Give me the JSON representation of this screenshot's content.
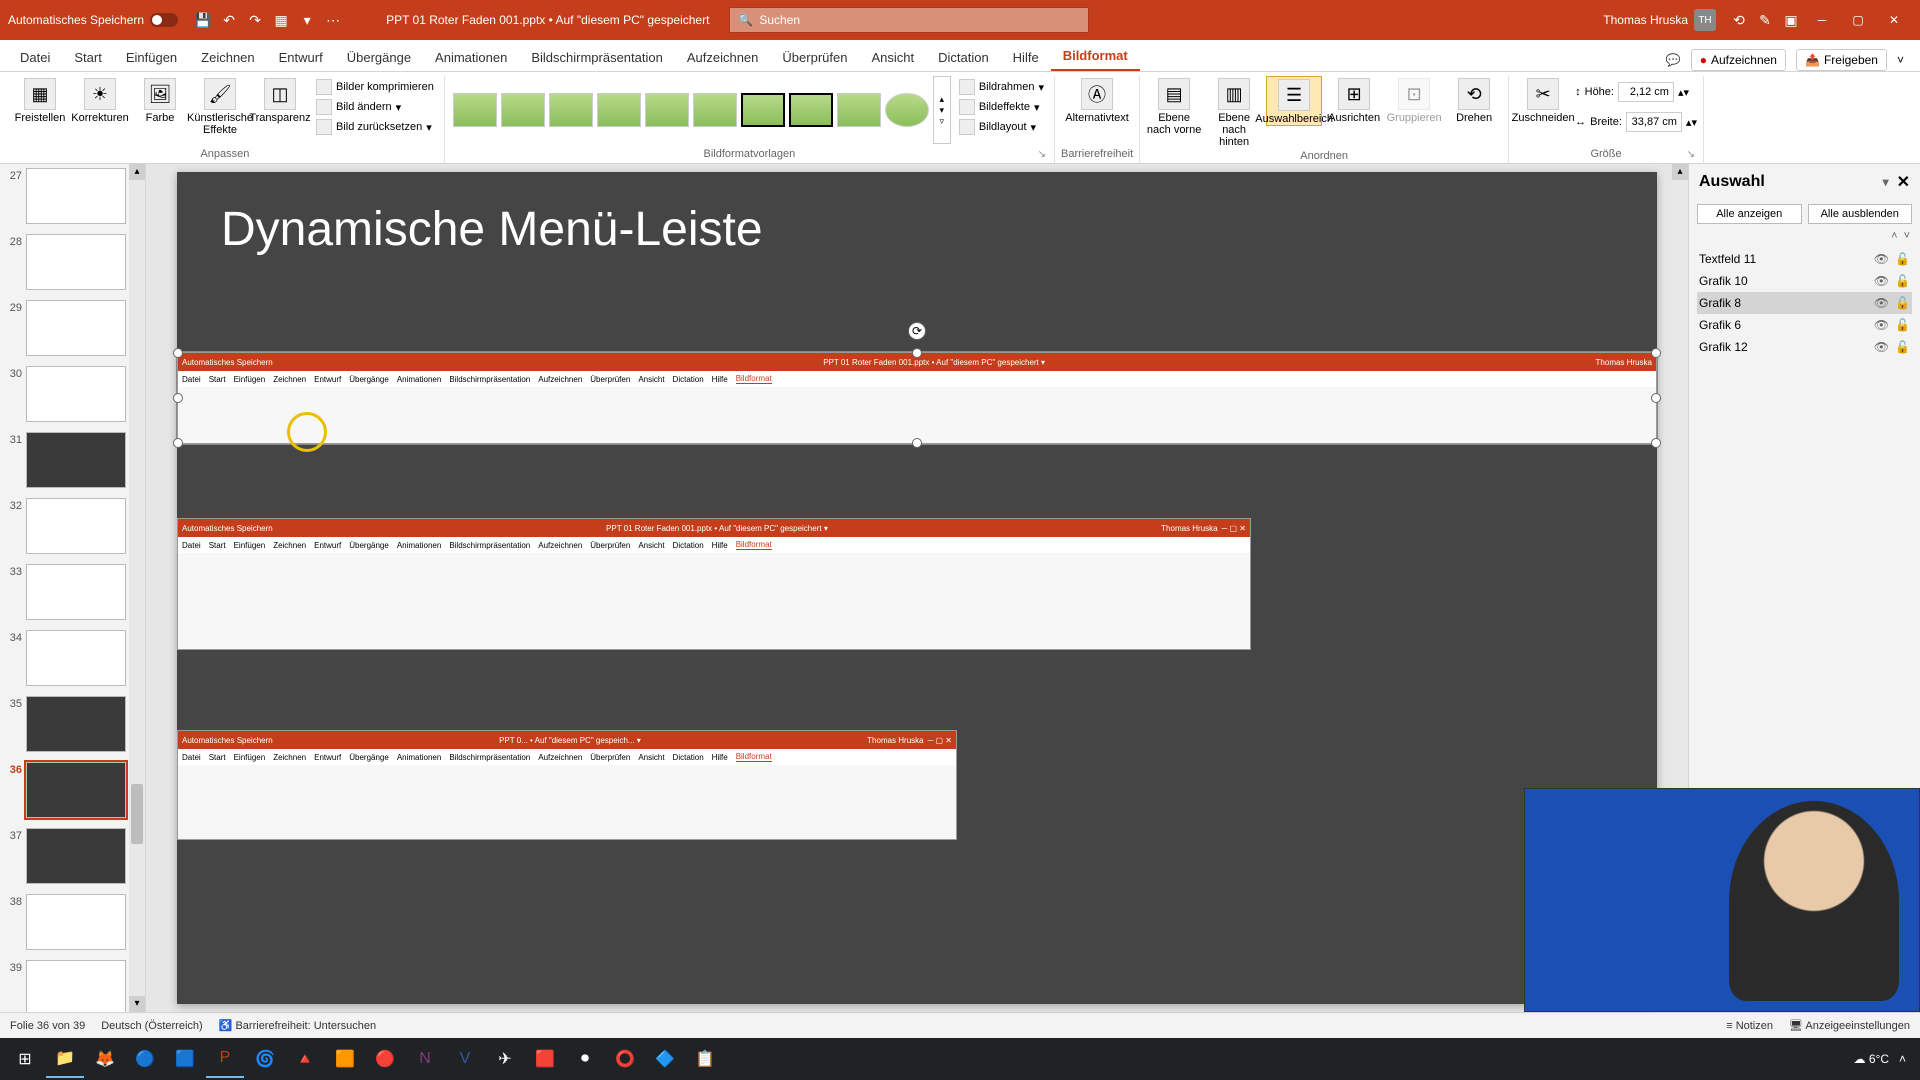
{
  "titlebar": {
    "autosave": "Automatisches Speichern",
    "doc_title": "PPT 01 Roter Faden 001.pptx • Auf \"diesem PC\" gespeichert",
    "search_placeholder": "Suchen",
    "user_name": "Thomas Hruska",
    "user_initials": "TH"
  },
  "tabs": {
    "datei": "Datei",
    "start": "Start",
    "einfuegen": "Einfügen",
    "zeichnen": "Zeichnen",
    "entwurf": "Entwurf",
    "uebergaenge": "Übergänge",
    "animationen": "Animationen",
    "bildschirm": "Bildschirmpräsentation",
    "aufzeichnen": "Aufzeichnen",
    "ueberpruefen": "Überprüfen",
    "ansicht": "Ansicht",
    "dictation": "Dictation",
    "hilfe": "Hilfe",
    "bildformat": "Bildformat",
    "record": "Aufzeichnen",
    "share": "Freigeben"
  },
  "ribbon": {
    "freistellen": "Freistellen",
    "korrekturen": "Korrekturen",
    "farbe": "Farbe",
    "kuenstlerische": "Künstlerische Effekte",
    "transparenz": "Transparenz",
    "komprimieren": "Bilder komprimieren",
    "aendern": "Bild ändern",
    "zuruecksetzen": "Bild zurücksetzen",
    "anpassen": "Anpassen",
    "bildrahmen": "Bildrahmen",
    "bildeffekte": "Bildeffekte",
    "bildlayout": "Bildlayout",
    "vorlagen": "Bildformatvorlagen",
    "alternativtext": "Alternativtext",
    "barrierefreiheit": "Barrierefreiheit",
    "ebene_vorne": "Ebene nach vorne",
    "ebene_hinten": "Ebene nach hinten",
    "auswahlbereich": "Auswahlbereich",
    "ausrichten": "Ausrichten",
    "gruppieren": "Gruppieren",
    "drehen": "Drehen",
    "anordnen": "Anordnen",
    "zuschneiden": "Zuschneiden",
    "hoehe": "Höhe:",
    "hoehe_val": "2,12 cm",
    "breite": "Breite:",
    "breite_val": "33,87 cm",
    "groesse": "Größe"
  },
  "slide": {
    "title": "Dynamische Menü-Leiste"
  },
  "selection": {
    "title": "Auswahl",
    "show_all": "Alle anzeigen",
    "hide_all": "Alle ausblenden",
    "items": [
      {
        "name": "Textfeld 11"
      },
      {
        "name": "Grafik 10"
      },
      {
        "name": "Grafik 8"
      },
      {
        "name": "Grafik 6"
      },
      {
        "name": "Grafik 12"
      }
    ]
  },
  "thumbs": [
    {
      "num": "27"
    },
    {
      "num": "28"
    },
    {
      "num": "29"
    },
    {
      "num": "30"
    },
    {
      "num": "31"
    },
    {
      "num": "32"
    },
    {
      "num": "33"
    },
    {
      "num": "34"
    },
    {
      "num": "35"
    },
    {
      "num": "36"
    },
    {
      "num": "37"
    },
    {
      "num": "38"
    },
    {
      "num": "39"
    }
  ],
  "status": {
    "slide": "Folie 36 von 39",
    "lang": "Deutsch (Österreich)",
    "access": "Barrierefreiheit: Untersuchen",
    "notizen": "Notizen",
    "anzeige": "Anzeigeeinstellungen"
  },
  "taskbar": {
    "temp": "6°C"
  }
}
